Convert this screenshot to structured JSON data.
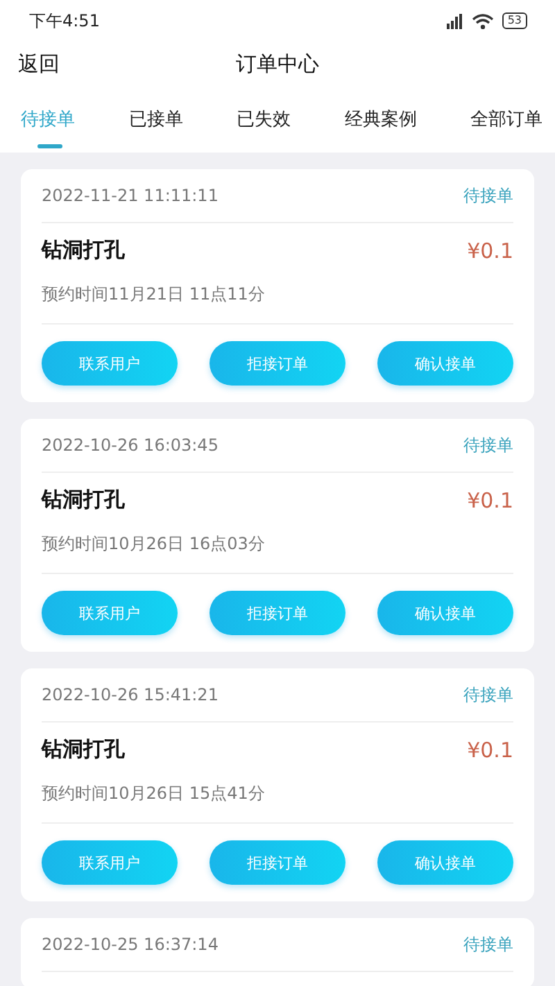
{
  "status_bar": {
    "time": "下午4:51",
    "battery": "53"
  },
  "header": {
    "back": "返回",
    "title": "订单中心"
  },
  "tabs": [
    {
      "label": "待接单",
      "selected": true
    },
    {
      "label": "已接单",
      "selected": false
    },
    {
      "label": "已失效",
      "selected": false
    },
    {
      "label": "经典案例",
      "selected": false
    },
    {
      "label": "全部订单",
      "selected": false
    }
  ],
  "orders": [
    {
      "created": "2022-11-21 11:11:11",
      "status": "待接单",
      "service": "钻洞打孔",
      "price": "¥0.1",
      "appointment": "预约时间11月21日 11点11分",
      "actions": [
        "联系用户",
        "拒接订单",
        "确认接单"
      ]
    },
    {
      "created": "2022-10-26 16:03:45",
      "status": "待接单",
      "service": "钻洞打孔",
      "price": "¥0.1",
      "appointment": "预约时间10月26日 16点03分",
      "actions": [
        "联系用户",
        "拒接订单",
        "确认接单"
      ]
    },
    {
      "created": "2022-10-26 15:41:21",
      "status": "待接单",
      "service": "钻洞打孔",
      "price": "¥0.1",
      "appointment": "预约时间10月26日 15点41分",
      "actions": [
        "联系用户",
        "拒接订单",
        "确认接单"
      ]
    },
    {
      "created": "2022-10-25 16:37:14",
      "status": "待接单"
    }
  ]
}
